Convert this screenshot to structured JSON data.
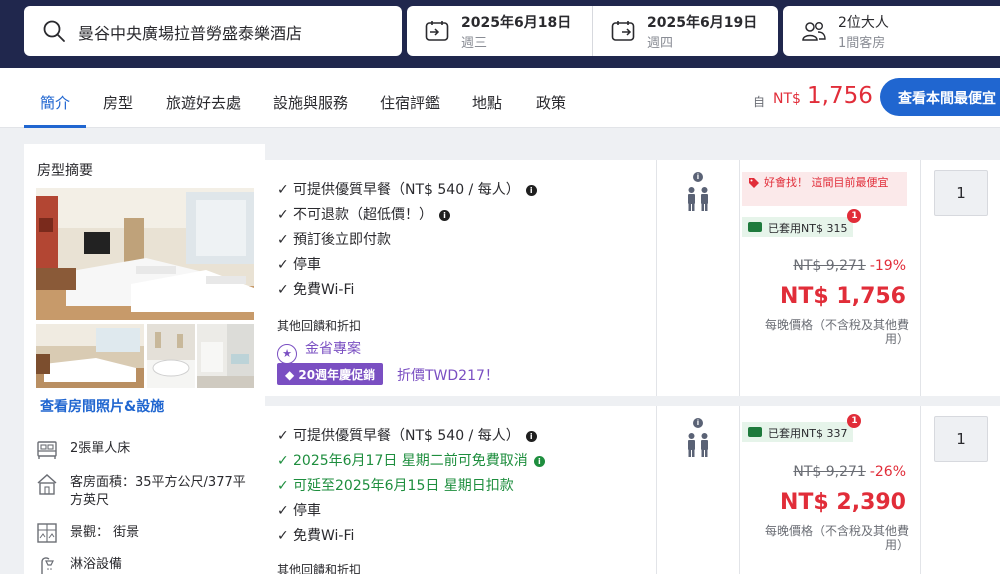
{
  "search": {
    "destination": "曼谷中央廣場拉普勞盛泰樂酒店",
    "checkin": {
      "date": "2025年6月18日",
      "weekday": "週三"
    },
    "checkout": {
      "date": "2025年6月19日",
      "weekday": "週四"
    },
    "guests": {
      "adults": "2位大人",
      "rooms": "1間客房"
    }
  },
  "nav": {
    "tabs": [
      "簡介",
      "房型",
      "旅遊好去處",
      "設施與服務",
      "住宿評鑑",
      "地點",
      "政策"
    ],
    "active_tab": "簡介",
    "price_from_label": "自",
    "price_currency": "NT$",
    "price_amount": "1,756",
    "cta_label": "查看本間最便宜"
  },
  "room_summary": {
    "title": "房型摘要",
    "view_photos_label": "查看房間照片&設施",
    "features": [
      {
        "icon": "bed-icon",
        "text": "2張單人床"
      },
      {
        "icon": "house-icon",
        "text": "客房面積：35平方公尺/377平方英尺"
      },
      {
        "icon": "window-icon",
        "text": "景觀： 街景"
      },
      {
        "icon": "shower-icon",
        "text": "淋浴設備"
      }
    ]
  },
  "offers": [
    {
      "benefits": [
        {
          "text": "可提供優質早餐（NT$ 540 / 每人）",
          "info": true,
          "green": false
        },
        {
          "text": "不可退款（超低價！）",
          "info": true,
          "green": false
        },
        {
          "text": "預訂後立即付款",
          "info": false,
          "green": false
        },
        {
          "text": "停車",
          "info": false,
          "green": false
        },
        {
          "text": "免費Wi-Fi",
          "info": false,
          "green": false
        }
      ],
      "other_title": "其他回饋和折扣",
      "promo_label": "金省專案",
      "anniversary_badge": "20週年慶促銷",
      "anniversary_note": "折價TWD217！",
      "deal_text": "好會找！ 這間目前最便宜",
      "coupon_text": "已套用NT$ 315",
      "coupon_count": "1",
      "original_price": "NT$ 9,271",
      "discount": "-19%",
      "price": "NT$ 1,756",
      "per_night_note": "每晚價格（不含稅及其他費用）",
      "quantity": "1"
    },
    {
      "benefits": [
        {
          "text": "可提供優質早餐（NT$ 540 / 每人）",
          "info": true,
          "green": false
        },
        {
          "text": "2025年6月17日 星期二前可免費取消",
          "info": true,
          "green": true
        },
        {
          "text": "可延至2025年6月15日 星期日扣款",
          "info": false,
          "green": true
        },
        {
          "text": "停車",
          "info": false,
          "green": false
        },
        {
          "text": "免費Wi-Fi",
          "info": false,
          "green": false
        }
      ],
      "other_title": "其他回饋和折扣",
      "coupon_text": "已套用NT$ 337",
      "coupon_count": "1",
      "original_price": "NT$ 9,271",
      "discount": "-26%",
      "price": "NT$ 2,390",
      "per_night_note": "每晚價格（不含稅及其他費用）",
      "quantity": "1"
    }
  ],
  "colors": {
    "header_bg": "#20274d",
    "accent_blue": "#2066d0",
    "price_red": "#e12d39",
    "promo_purple": "#7a4fc2",
    "success_green": "#1e8e3e"
  }
}
